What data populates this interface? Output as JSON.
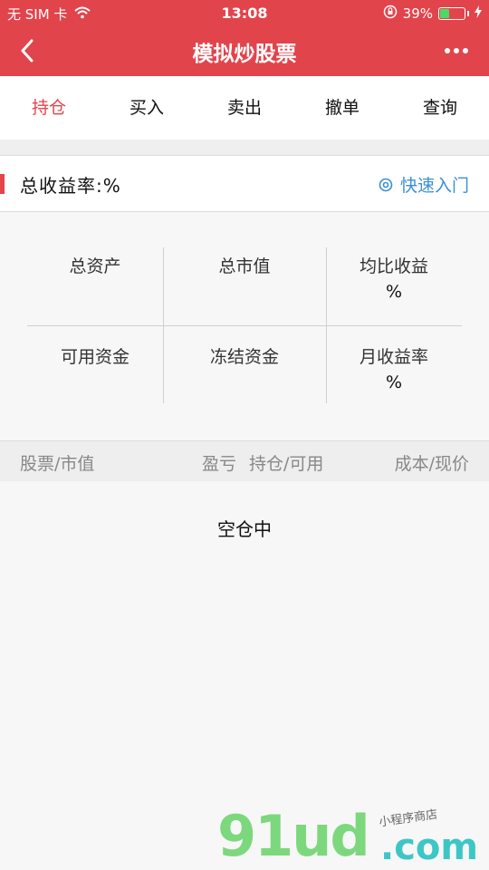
{
  "status_bar": {
    "carrier": "无 SIM 卡",
    "time": "13:08",
    "battery_percent": "39%"
  },
  "nav": {
    "title": "模拟炒股票"
  },
  "tabs": [
    {
      "label": "持仓",
      "active": true
    },
    {
      "label": "买入",
      "active": false
    },
    {
      "label": "卖出",
      "active": false
    },
    {
      "label": "撤单",
      "active": false
    },
    {
      "label": "查询",
      "active": false
    }
  ],
  "summary": {
    "total_return_label": "总收益率:%",
    "quick_start": "快速入门"
  },
  "stats": {
    "total_assets": {
      "label": "总资产",
      "value": ""
    },
    "total_market_value": {
      "label": "总市值",
      "value": ""
    },
    "avg_return": {
      "label": "均比收益",
      "value": "%"
    },
    "available_funds": {
      "label": "可用资金",
      "value": ""
    },
    "frozen_funds": {
      "label": "冻结资金",
      "value": ""
    },
    "monthly_return": {
      "label": "月收益率",
      "value": "%"
    }
  },
  "table_header": {
    "stock_market_value": "股票/市值",
    "profit_loss": "盈亏",
    "holding_available": "持仓/可用",
    "cost_price": "成本/现价"
  },
  "empty_text": "空仓中",
  "watermark": {
    "main": "91ud",
    "domain": ".com",
    "sub": "小程序商店"
  },
  "colors": {
    "brand_red": "#e2444c",
    "link_blue": "#3a8fd6",
    "battery_green": "#4cd964"
  }
}
